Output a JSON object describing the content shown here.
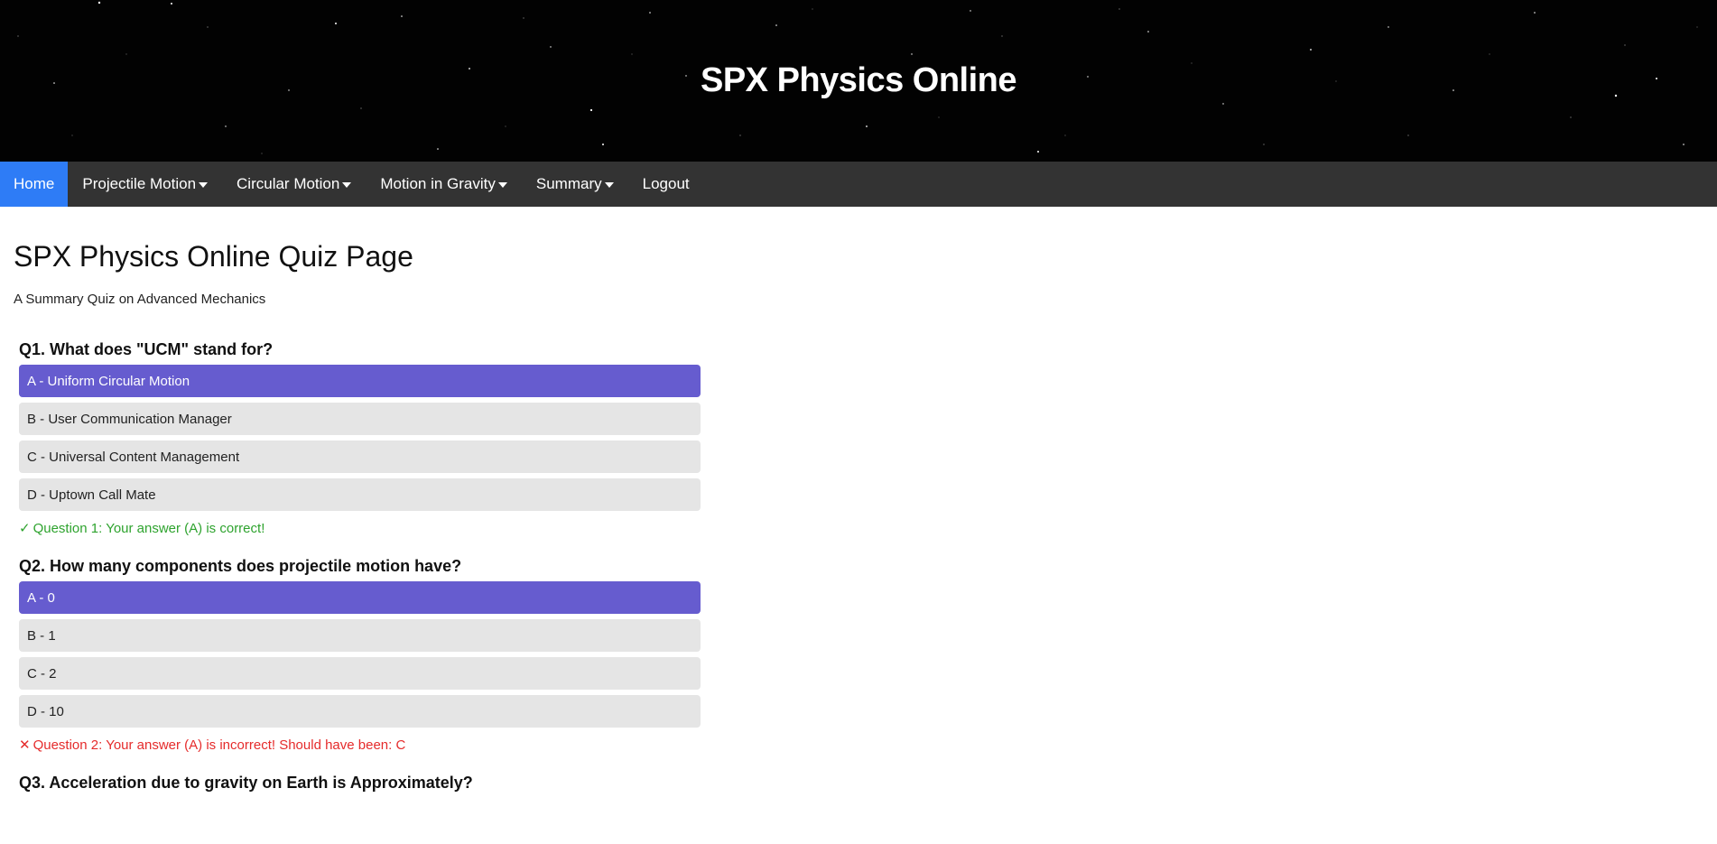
{
  "header": {
    "title": "SPX Physics Online"
  },
  "nav": {
    "items": [
      {
        "label": "Home",
        "active": true,
        "dropdown": false
      },
      {
        "label": "Projectile Motion",
        "active": false,
        "dropdown": true
      },
      {
        "label": "Circular Motion",
        "active": false,
        "dropdown": true
      },
      {
        "label": "Motion in Gravity",
        "active": false,
        "dropdown": true
      },
      {
        "label": "Summary",
        "active": false,
        "dropdown": true
      },
      {
        "label": "Logout",
        "active": false,
        "dropdown": false
      }
    ]
  },
  "page": {
    "title": "SPX Physics Online Quiz Page",
    "subtitle": "A Summary Quiz on Advanced Mechanics"
  },
  "quiz": {
    "questions": [
      {
        "text": "Q1. What does \"UCM\" stand for?",
        "options": [
          "A - Uniform Circular Motion",
          "B - User Communication Manager",
          "C - Universal Content Management",
          "D - Uptown Call Mate"
        ],
        "selected_index": 0,
        "feedback": {
          "status": "correct",
          "icon": "check-icon",
          "glyph": "✓",
          "text": "Question 1: Your answer (A) is correct!"
        }
      },
      {
        "text": "Q2. How many components does projectile motion have?",
        "options": [
          "A - 0",
          "B - 1",
          "C - 2",
          "D - 10"
        ],
        "selected_index": 0,
        "feedback": {
          "status": "incorrect",
          "icon": "cross-icon",
          "glyph": "✕",
          "text": "Question 2: Your answer (A) is incorrect! Should have been: C"
        }
      },
      {
        "text": "Q3. Acceleration due to gravity on Earth is Approximately?",
        "options": [],
        "selected_index": null,
        "feedback": null
      }
    ]
  },
  "colors": {
    "header_bg": "#020202",
    "nav_bg": "#333333",
    "nav_active": "#2e7cf6",
    "option_bg": "#e5e5e5",
    "option_selected": "#665ccf",
    "correct": "#2ea32e",
    "incorrect": "#e52b2b"
  }
}
